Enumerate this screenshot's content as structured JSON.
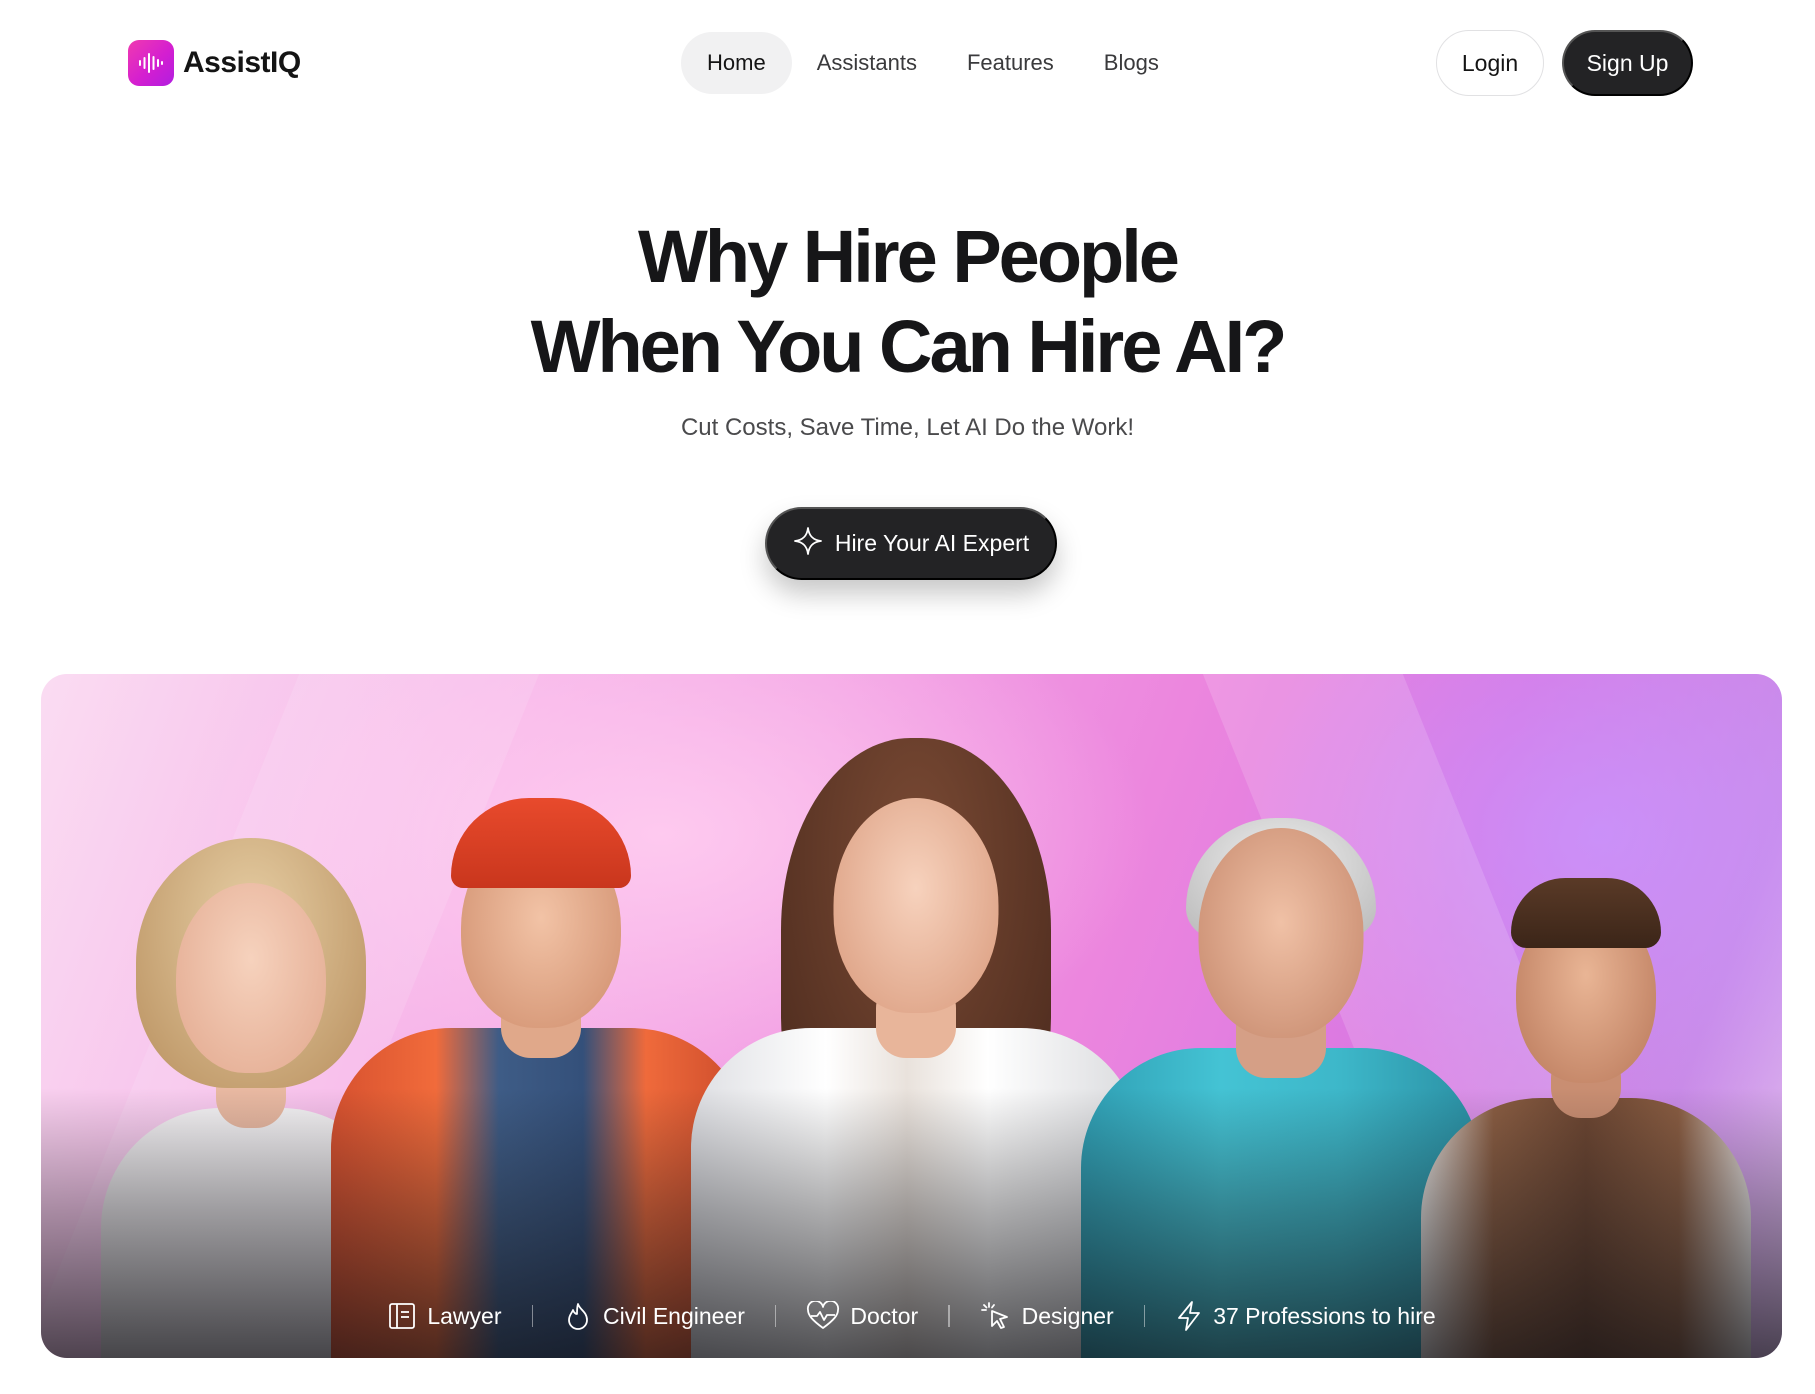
{
  "brand": {
    "name": "AssistIQ",
    "logo_icon": "audio-wave-icon",
    "accent": "#e33bc8"
  },
  "nav": {
    "links": [
      {
        "label": "Home",
        "active": true
      },
      {
        "label": "Assistants",
        "active": false
      },
      {
        "label": "Features",
        "active": false
      },
      {
        "label": "Blogs",
        "active": false
      }
    ],
    "login_label": "Login",
    "signup_label": "Sign Up"
  },
  "hero": {
    "title_line1": "Why Hire People",
    "title_line2": "When You Can Hire AI?",
    "subtitle": "Cut Costs, Save Time, Let AI Do the Work!",
    "cta_label": "Hire Your AI Expert",
    "cta_icon": "sparkle-icon"
  },
  "banner": {
    "tags": [
      {
        "label": "Lawyer",
        "icon": "document-icon"
      },
      {
        "label": "Civil Engineer",
        "icon": "flame-icon"
      },
      {
        "label": "Doctor",
        "icon": "heartbeat-icon"
      },
      {
        "label": "Designer",
        "icon": "cursor-click-icon"
      },
      {
        "label": "37 Professions to hire",
        "icon": "lightning-icon"
      }
    ]
  }
}
